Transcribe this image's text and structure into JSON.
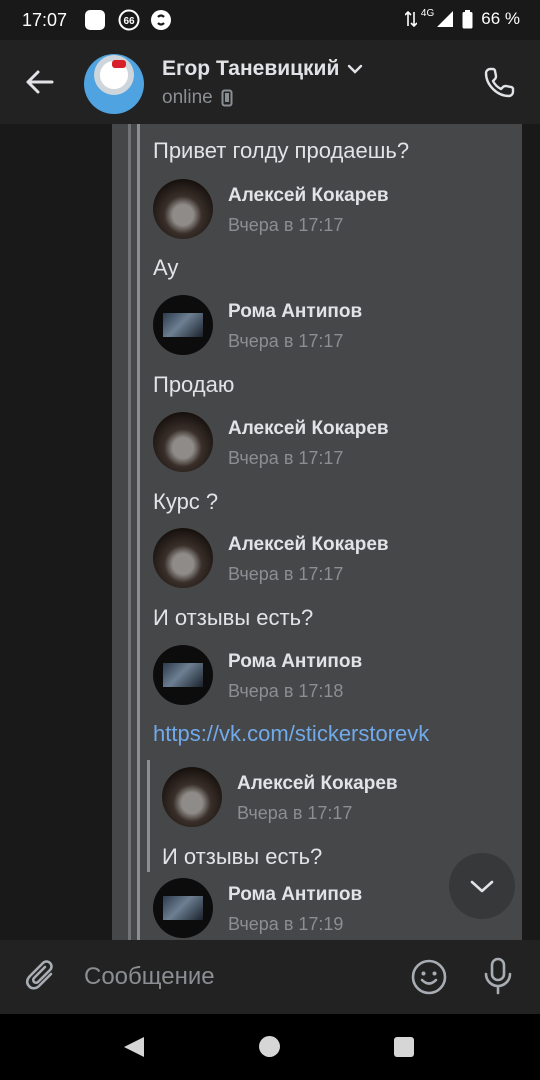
{
  "status_bar": {
    "time": "17:07",
    "notification_badge": "66",
    "network": "4G",
    "battery": "66 %"
  },
  "header": {
    "contact_name": "Егор Таневицкий",
    "status": "online"
  },
  "messages": [
    {
      "type": "text",
      "text": "Привет голду продаешь?"
    },
    {
      "type": "author",
      "name": "Алексей Кокарев",
      "time": "Вчера в 17:17"
    },
    {
      "type": "text",
      "text": "Ау"
    },
    {
      "type": "author",
      "name": "Рома Антипов",
      "time": "Вчера в 17:17"
    },
    {
      "type": "text",
      "text": "Продаю"
    },
    {
      "type": "author",
      "name": "Алексей Кокарев",
      "time": "Вчера в 17:17"
    },
    {
      "type": "text",
      "text": "Курс ?"
    },
    {
      "type": "author",
      "name": "Алексей Кокарев",
      "time": "Вчера в 17:17"
    },
    {
      "type": "text",
      "text": "И отзывы есть?"
    },
    {
      "type": "author",
      "name": "Рома Антипов",
      "time": "Вчера в 17:18"
    },
    {
      "type": "link",
      "text": "https://vk.com/stickerstorevk"
    },
    {
      "type": "author",
      "name": "Алексей Кокарев",
      "time": "Вчера в 17:17"
    },
    {
      "type": "text",
      "text": "И отзывы есть?"
    },
    {
      "type": "author",
      "name": "Рома Антипов",
      "time": "Вчера в 17:19"
    }
  ],
  "composer": {
    "placeholder": "Сообщение"
  },
  "colors": {
    "background": "#19191a",
    "bubble": "#464749",
    "link": "#71aaeb",
    "secondary_text": "#8b8e92"
  }
}
